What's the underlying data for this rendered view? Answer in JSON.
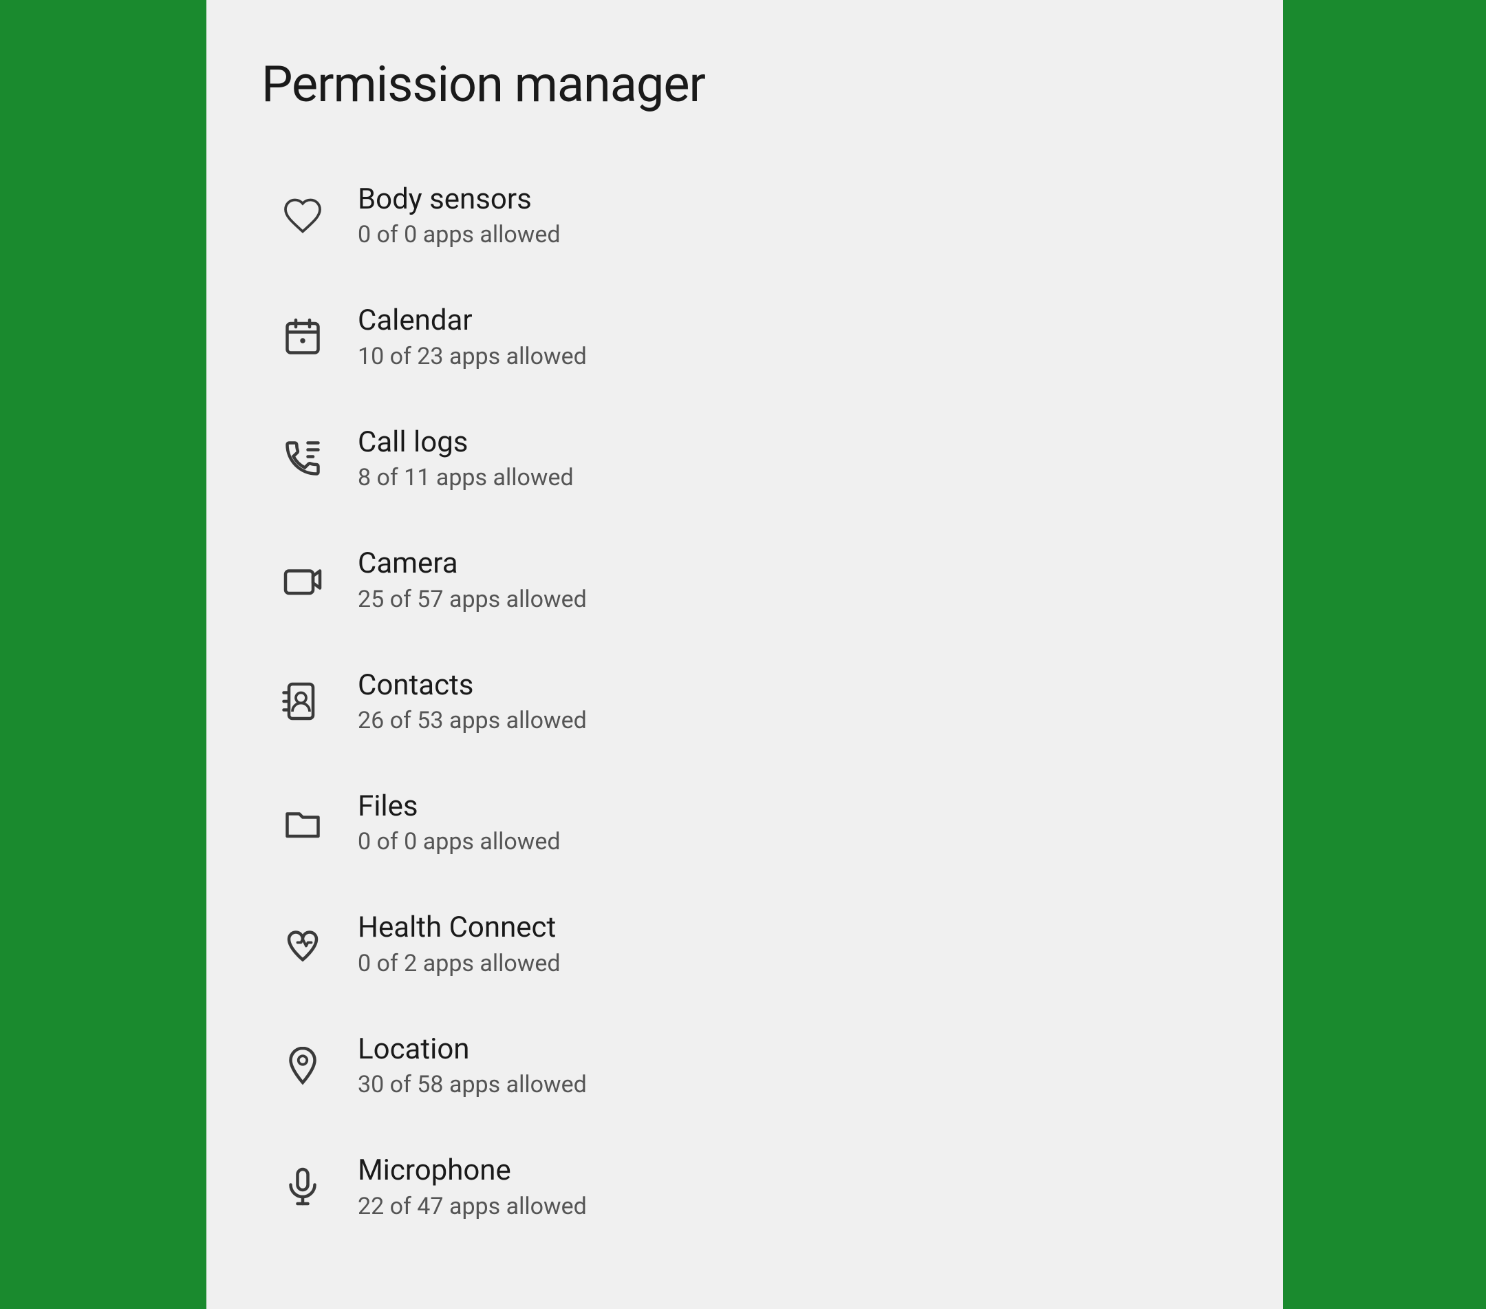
{
  "page": {
    "title": "Permission manager"
  },
  "sidebar": {
    "bg_color": "#1a8a2e"
  },
  "permissions": [
    {
      "id": "body-sensors",
      "name": "Body sensors",
      "subtitle": "0 of 0 apps allowed",
      "icon": "heart"
    },
    {
      "id": "calendar",
      "name": "Calendar",
      "subtitle": "10 of 23 apps allowed",
      "icon": "calendar"
    },
    {
      "id": "call-logs",
      "name": "Call logs",
      "subtitle": "8 of 11 apps allowed",
      "icon": "call-logs"
    },
    {
      "id": "camera",
      "name": "Camera",
      "subtitle": "25 of 57 apps allowed",
      "icon": "camera"
    },
    {
      "id": "contacts",
      "name": "Contacts",
      "subtitle": "26 of 53 apps allowed",
      "icon": "contacts"
    },
    {
      "id": "files",
      "name": "Files",
      "subtitle": "0 of 0 apps allowed",
      "icon": "folder"
    },
    {
      "id": "health-connect",
      "name": "Health Connect",
      "subtitle": "0 of 2 apps allowed",
      "icon": "health-connect"
    },
    {
      "id": "location",
      "name": "Location",
      "subtitle": "30 of 58 apps allowed",
      "icon": "location"
    },
    {
      "id": "microphone",
      "name": "Microphone",
      "subtitle": "22 of 47 apps allowed",
      "icon": "microphone"
    }
  ]
}
